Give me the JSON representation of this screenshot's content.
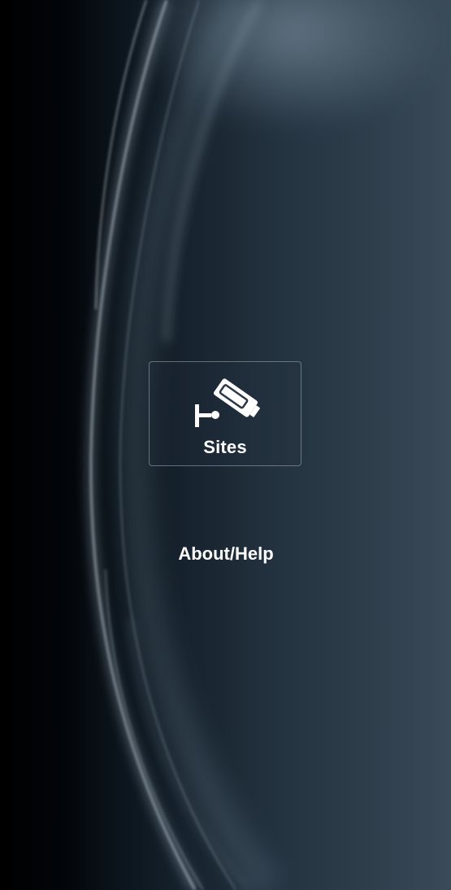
{
  "menu": {
    "sites_label": "Sites",
    "sites_icon": "security-camera-icon",
    "about_label": "About/Help"
  },
  "colors": {
    "background_dark": "#000000",
    "background_light": "#3a4a58",
    "text": "#ffffff",
    "button_border": "#a0acb8"
  }
}
